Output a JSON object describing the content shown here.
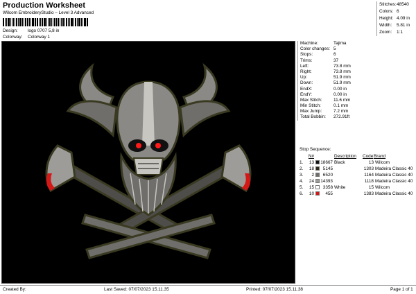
{
  "header": {
    "title": "Production Worksheet",
    "subtitle": "Wilcom EmbroideryStudio – Level 3 Advanced"
  },
  "meta": {
    "design_label": "Design:",
    "design_value": "logo 0707 5,8 in",
    "colorway_label": "Colorway:",
    "colorway_value": "Colorway 1"
  },
  "top_stats": [
    {
      "label": "Stitches:",
      "value": "48540"
    },
    {
      "label": "Colors:",
      "value": "6"
    },
    {
      "label": "Height:",
      "value": "4.09 in"
    },
    {
      "label": "Width:",
      "value": "5.81 in"
    },
    {
      "label": "Zoom:",
      "value": "1:1"
    }
  ],
  "machine_info": [
    {
      "label": "Machine:",
      "value": "Tajima"
    },
    {
      "label": "Color changes:",
      "value": "5"
    },
    {
      "label": "Stops:",
      "value": "6"
    },
    {
      "label": "Trims:",
      "value": "37"
    },
    {
      "label": "Left:",
      "value": "73.8 mm"
    },
    {
      "label": "Right:",
      "value": "73.8 mm"
    },
    {
      "label": "Up:",
      "value": "51.9 mm"
    },
    {
      "label": "Down:",
      "value": "51.9 mm"
    },
    {
      "label": "EndX:",
      "value": "0.00 in"
    },
    {
      "label": "EndY:",
      "value": "0.00 in"
    },
    {
      "label": "Max Stitch:",
      "value": "11.6 mm"
    },
    {
      "label": "Min Stitch:",
      "value": "0.1 mm"
    },
    {
      "label": "Max Jump:",
      "value": "7.2 mm"
    },
    {
      "label": "Total Bobbin:",
      "value": "272.91ft"
    }
  ],
  "stop_sequence": {
    "title": "Stop Sequence:",
    "headers": {
      "n": "N#",
      "description": "Description",
      "code": "Code",
      "brand": "Brand"
    },
    "rows": [
      {
        "stop": "1.",
        "n": "13",
        "swatch": "#111111",
        "num": "18667",
        "description": "Black",
        "code": "13",
        "brand": "Wilcom"
      },
      {
        "stop": "2.",
        "n": "18",
        "swatch": "#2e2a16",
        "num": "5145",
        "description": "",
        "code": "1303",
        "brand": "Madeira Classic 40"
      },
      {
        "stop": "3.",
        "n": "2",
        "swatch": "#6f6e6a",
        "num": "6520",
        "description": "",
        "code": "1164",
        "brand": "Madeira Classic 40"
      },
      {
        "stop": "4.",
        "n": "24",
        "swatch": "#9e9c98",
        "num": "14393",
        "description": "",
        "code": "1118",
        "brand": "Madeira Classic 40"
      },
      {
        "stop": "5.",
        "n": "15",
        "swatch": "#ffffff",
        "num": "3358",
        "description": "White",
        "code": "15",
        "brand": "Wilcom"
      },
      {
        "stop": "6.",
        "n": "10",
        "swatch": "#d41818",
        "num": "455",
        "description": "",
        "code": "1383",
        "brand": "Madeira Classic 40"
      }
    ]
  },
  "footer": {
    "created_by": "Created By:",
    "last_saved": "Last Saved: 07/07/2023 15.11.35",
    "printed": "Printed: 07/07/2023 15.11.38",
    "page": "Page 1 of 1"
  },
  "design_colors": {
    "background": "#000000",
    "outline": "#3a3a22",
    "metal": "#8a8985",
    "metal_light": "#c7c6c1",
    "metal_dark": "#4e4d49",
    "blade_edge": "#d41818",
    "eye": "#ff1a1a"
  }
}
